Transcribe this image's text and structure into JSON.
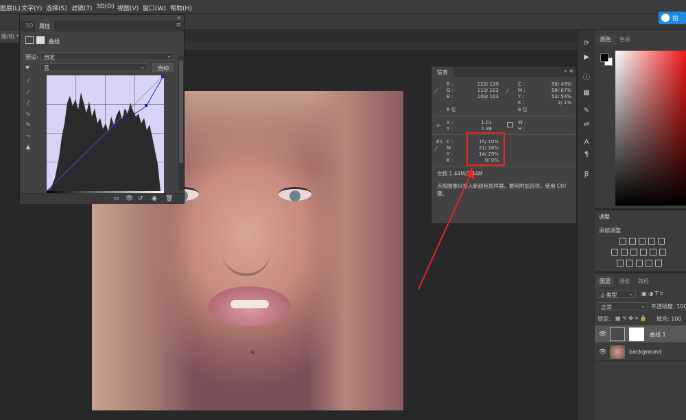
{
  "menu": [
    "图层(L)",
    "文字(Y)",
    "选择(S)",
    "滤镜(T)",
    "3D(D)",
    "视图(V)",
    "窗口(W)",
    "帮助(H)"
  ],
  "cloud_button": "拍",
  "doc_tab": "版/8) *",
  "properties": {
    "tabs": [
      "3D",
      "属性"
    ],
    "close": "×",
    "panel_menu": "≡",
    "title": "曲线",
    "preset_label": "预设:",
    "preset_value": "自定",
    "channel_value": "蓝",
    "auto_button": "自动",
    "histogram_color": "#2a2a2a",
    "curve_color": "#2222aa"
  },
  "info": {
    "tab": "信息",
    "rgb": {
      "R": "122/ 139",
      "G": "110/ 102",
      "B": "109/ 103",
      "bits": "8 位"
    },
    "cmyk": {
      "C": "58/ 49%",
      "M": "58/ 67%",
      "Y": "53/ 54%",
      "K": "2/ 1%",
      "bits": "8 位"
    },
    "xy": {
      "X": "1.01",
      "Y": "0.36"
    },
    "wh": {
      "W": "",
      "H": ""
    },
    "sample": {
      "id": "#1",
      "C": "15/ 10%",
      "M": "21/ 26%",
      "Y": "14/ 29%",
      "K": "0/ 0%"
    },
    "doc": "文档:1.44M/1.44M",
    "message": "点按图像以置入新颜色取样器。要用附加选项，使用 Ctrl 键。"
  },
  "color_panel": {
    "tabs": [
      "颜色",
      "色板"
    ]
  },
  "adjustments": {
    "title": "调整",
    "subtitle": "添加调整"
  },
  "layers": {
    "tabs": [
      "图层",
      "通道",
      "路径"
    ],
    "filter": "ρ 类型",
    "blend": "正常",
    "opacity_label": "不透明度: 100",
    "lock_label": "锁定:",
    "fill_label": "填充: 100",
    "items": [
      {
        "name": "曲线 1"
      },
      {
        "name": "background"
      }
    ]
  }
}
